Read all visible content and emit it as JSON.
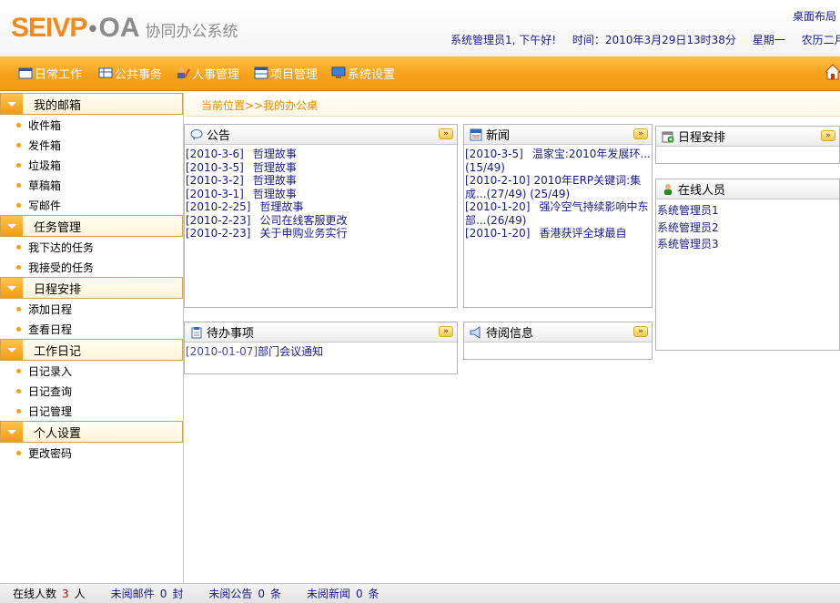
{
  "header": {
    "logo_main": "SEIVP",
    "logo_dot": "•",
    "logo_oa": "OA",
    "logo_sub": "协同办公系统",
    "desk_layout": "桌面布局",
    "greeting": "系统管理员1, 下午好!",
    "time": "时间：2010年3月29日13时38分",
    "weekday": "星期一",
    "lunar": "农历二月十四"
  },
  "nav": {
    "items": [
      {
        "label": "日常工作",
        "icon": "calendar-icon"
      },
      {
        "label": "公共事务",
        "icon": "table-icon"
      },
      {
        "label": "人事管理",
        "icon": "person-edit-icon"
      },
      {
        "label": "项目管理",
        "icon": "grid-icon"
      },
      {
        "label": "系统设置",
        "icon": "monitor-icon"
      }
    ],
    "home_icon": "home-icon"
  },
  "sidebar": {
    "sections": [
      {
        "title": "我的邮箱",
        "items": [
          "收件箱",
          "发件箱",
          "垃圾箱",
          "草稿箱",
          "写邮件"
        ]
      },
      {
        "title": "任务管理",
        "items": [
          "我下达的任务",
          "我接受的任务"
        ]
      },
      {
        "title": "日程安排",
        "items": [
          "添加日程",
          "查看日程"
        ]
      },
      {
        "title": "工作日记",
        "items": [
          "日记录入",
          "日记查询",
          "日记管理"
        ]
      },
      {
        "title": "个人设置",
        "items": [
          "更改密码"
        ]
      }
    ]
  },
  "breadcrumb": "当前位置>>我的办公桌",
  "panels": {
    "notice": {
      "title": "公告",
      "items": [
        {
          "date": "[2010-3-6]",
          "text": "哲理故事"
        },
        {
          "date": "[2010-3-5]",
          "text": "哲理故事"
        },
        {
          "date": "[2010-3-2]",
          "text": "哲理故事"
        },
        {
          "date": "[2010-3-1]",
          "text": "哲理故事"
        },
        {
          "date": "[2010-2-25]",
          "text": "哲理故事"
        },
        {
          "date": "[2010-2-23]",
          "text": "公司在线客服更改"
        },
        {
          "date": "[2010-2-23]",
          "text": "关于申购业务实行"
        }
      ]
    },
    "news": {
      "title": "新闻",
      "items": [
        {
          "date": "[2010-3-5]",
          "text": "温家宝:2010年发展环...(15/49)"
        },
        {
          "date": "[2010-2-10]",
          "text": "2010年ERP关键词:集成...(27/49) (25/49)"
        },
        {
          "date": "[2010-1-20]",
          "text": "强冷空气持续影响中东部...(26/49)"
        },
        {
          "date": "[2010-1-20]",
          "text": "香港获评全球最自"
        }
      ]
    },
    "schedule": {
      "title": "日程安排"
    },
    "online": {
      "title": "在线人员",
      "users": [
        "系统管理员1",
        "系统管理员2",
        "系统管理员3"
      ]
    },
    "todo": {
      "title": "待办事项",
      "items": [
        {
          "date": "[2010-01-07]",
          "text": "部门会议通知"
        }
      ]
    },
    "toread": {
      "title": "待阅信息"
    }
  },
  "footer": {
    "online_label": "在线人数",
    "online_count": "3",
    "online_unit": "人",
    "mail_label": "未阅邮件",
    "mail_count": "0",
    "mail_unit": "封",
    "notice_label": "未阅公告",
    "notice_count": "0",
    "notice_unit": "条",
    "news_label": "未阅新闻",
    "news_count": "0",
    "news_unit": "条"
  },
  "colors": {
    "nav_orange": "#f7a21b",
    "link_blue": "#1a1a8c",
    "bullet_orange": "#f2a11a",
    "breadcrumb_orange": "#e58a00"
  }
}
